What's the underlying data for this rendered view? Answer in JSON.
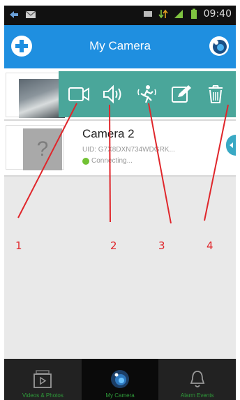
{
  "status_bar": {
    "time": "09:40",
    "left_icons": [
      "back-notification-icon",
      "mail-icon"
    ],
    "right_icons": [
      "sim-icon",
      "data-arrows-icon",
      "signal-icon",
      "battery-icon"
    ]
  },
  "header": {
    "title": "My Camera",
    "left_button_icon": "add-icon",
    "right_button_icon": "settings-icon"
  },
  "cameras": [
    {
      "thumbnail": "camera-preview-photo",
      "actions": [
        {
          "id": "1",
          "icon": "video-icon"
        },
        {
          "id": "2",
          "icon": "speaker-icon"
        },
        {
          "id": "3",
          "icon": "motion-detection-icon"
        },
        {
          "id": "4",
          "icon": "edit-icon"
        },
        {
          "id": "5",
          "icon": "trash-icon"
        }
      ]
    },
    {
      "thumbnail": "unknown-camera-placeholder",
      "name": "Camera 2",
      "uid": "UID: G7X8DXN734WDGRK...",
      "status": "Connecting..."
    }
  ],
  "annotation_labels": [
    "1",
    "2",
    "3",
    "4"
  ],
  "bottom_nav": [
    {
      "label": "Videos & Photos",
      "icon": "media-gallery-icon",
      "active": false
    },
    {
      "label": "My Camera",
      "icon": "camera-lens-icon",
      "active": true
    },
    {
      "label": "Alarm Events",
      "icon": "bell-icon",
      "active": false
    }
  ],
  "colors": {
    "header": "#1f8fe0",
    "action_bar": "#4aa69a",
    "annotation": "#e0262b",
    "status_connecting": "#72c234",
    "nav_label": "#2f9b3a"
  }
}
